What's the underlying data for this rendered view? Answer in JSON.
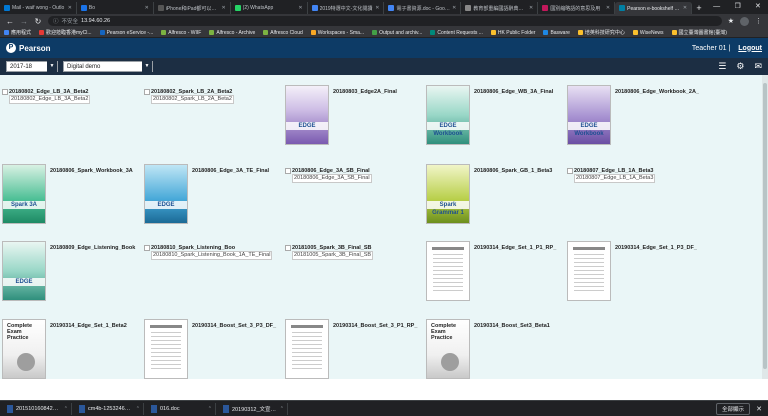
{
  "browser": {
    "tabs": [
      {
        "title": "Mail - waif wong - Outlo",
        "color": "#0078d4",
        "active": false
      },
      {
        "title": "Bo",
        "color": "#1a73e8",
        "active": false
      },
      {
        "title": "iPhone和iPad都可以使用",
        "color": "#555",
        "active": false
      },
      {
        "title": "(2) WhatsApp",
        "color": "#25d366",
        "active": false
      },
      {
        "title": "2019特選中文-文化閱讀",
        "color": "#4285f4",
        "active": false
      },
      {
        "title": "電子書資源.doc - Google 雲端",
        "color": "#4285f4",
        "active": false
      },
      {
        "title": "教育部重編國語辭典修訂本",
        "color": "#888",
        "active": false
      },
      {
        "title": "國別縮略語的意思及用",
        "color": "#c2185b",
        "active": false
      },
      {
        "title": "Pearson e-bookshelf 國際",
        "color": "#007fa3",
        "active": true
      }
    ],
    "new_tab": "+",
    "window_controls": [
      "—",
      "❐",
      "✕"
    ],
    "address": {
      "security": "不安全",
      "url": "13.94.60.26"
    },
    "bookmarks": [
      {
        "label": "應用程式",
        "color": "#4285f4"
      },
      {
        "label": "歡迎蒞臨香港myCl...",
        "color": "#e53935"
      },
      {
        "label": "Pearson eService -...",
        "color": "#1565c0"
      },
      {
        "label": "Alfresco - WIIF",
        "color": "#7cb342"
      },
      {
        "label": "Alfresco - Archive",
        "color": "#7cb342"
      },
      {
        "label": "Alfresco Cloud",
        "color": "#7cb342"
      },
      {
        "label": "Workspaces - Sma...",
        "color": "#f9a825"
      },
      {
        "label": "Output and archiv...",
        "color": "#43a047"
      },
      {
        "label": "Content Requests ...",
        "color": "#00897b"
      },
      {
        "label": "HK Public Folder",
        "color": "#fbc02d"
      },
      {
        "label": "Basware",
        "color": "#1e88e5"
      },
      {
        "label": "培英科技研究中心",
        "color": "#fbc02d"
      },
      {
        "label": "WiseNews",
        "color": "#fbc02d"
      },
      {
        "label": "國立臺灣圖書館(臺灣)",
        "color": "#fbc02d"
      }
    ]
  },
  "app": {
    "logo_letter": "P",
    "brand": "Pearson",
    "user": "Teacher 01 |",
    "logout": "Logout",
    "year": "2017-18",
    "library": "Digital demo",
    "caret": "▼"
  },
  "books": [
    {
      "title": "20180802_Edge_LB_3A_Beta2",
      "alt": "20180802_Edge_LB_3A_Beta2",
      "cover": "broken"
    },
    {
      "title": "20180802_Spark_LB_2A_Beta2",
      "alt": "20180802_Spark_LB_2A_Beta2",
      "cover": "broken"
    },
    {
      "title": "20180803_Edge2A_Final",
      "cover": "purple",
      "label": "EDGE"
    },
    {
      "title": "20180806_Edge_WB_3A_Final",
      "cover": "teal",
      "label": "EDGE Workbook"
    },
    {
      "title": "20180806_Edge_Workbook_2A_",
      "cover": "violet",
      "label": "EDGE Workbook"
    },
    {
      "title": "20180806_Spark_Workbook_3A",
      "cover": "green",
      "label": "Spark 3A"
    },
    {
      "title": "20180806_Edge_3A_TE_Final",
      "cover": "sky",
      "label": "EDGE"
    },
    {
      "title": "20180806_Edge_3A_SB_Final",
      "alt": "20180806_Edge_3A_SB_Final",
      "cover": "broken"
    },
    {
      "title": "20180806_Spark_GB_1_Beta3",
      "cover": "lime",
      "label": "Spark Grammar 1"
    },
    {
      "title": "20180807_Edge_LB_1A_Beta3",
      "alt": "20180807_Edge_LB_1A_Beta3",
      "cover": "broken"
    },
    {
      "title": "20180809_Edge_Listening_Book",
      "cover": "teal",
      "label": "EDGE"
    },
    {
      "title": "20180810_Spark_Listening_Boo",
      "alt": "20180810_Spark_Listening_Book_1A_TE_Final",
      "cover": "broken"
    },
    {
      "title": "20181005_Spark_3B_Final_SB",
      "alt": "20181005_Spark_3B_Final_SB",
      "cover": "broken"
    },
    {
      "title": "20190314_Edge_Set_1_P1_RP_",
      "cover": "doc"
    },
    {
      "title": "20190314_Edge_Set_1_P3_DF_",
      "cover": "doc"
    },
    {
      "title": "20190314_Edge_Set_1_Beta2",
      "cover": "grey",
      "label": "Complete Exam Practice"
    },
    {
      "title": "20190314_Boost_Set_3_P3_DF_",
      "cover": "doc"
    },
    {
      "title": "20190314_Boost_Set_3_P1_RP_",
      "cover": "doc"
    },
    {
      "title": "20190314_Boost_Set3_Beta1",
      "cover": "grey",
      "label": "Complete Exam Practice"
    }
  ],
  "downloads": [
    {
      "name": "20151016084245....doc"
    },
    {
      "name": "cm4b-12532463....doc"
    },
    {
      "name": "016.doc"
    },
    {
      "name": "20190312_文宣...docx"
    }
  ],
  "shelf": {
    "show_all": "全部顯示",
    "close": "✕"
  }
}
